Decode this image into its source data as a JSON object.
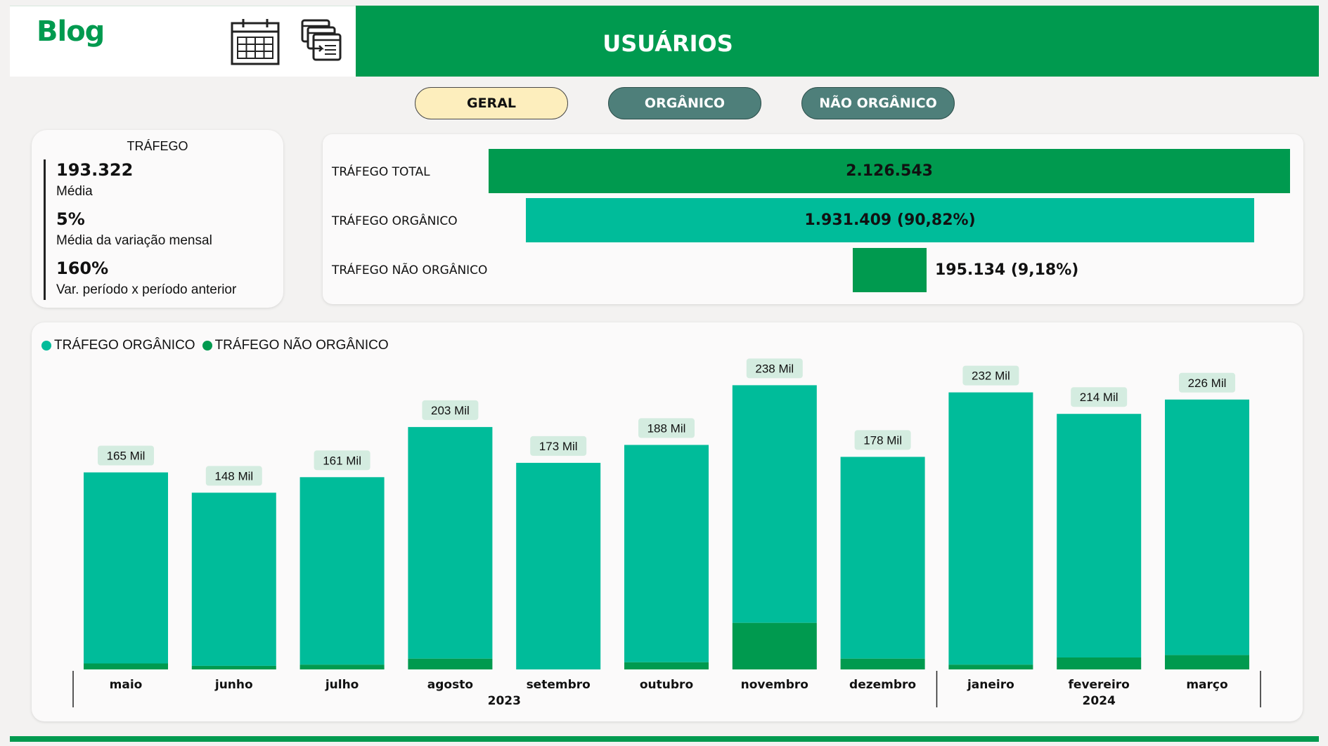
{
  "header": {
    "brand": "Blog",
    "title": "USUÁRIOS",
    "icons": [
      "calendar-table-icon",
      "report-export-icon"
    ]
  },
  "filters": {
    "geral": "GERAL",
    "organico": "ORGÂNICO",
    "nao_organico": "NÃO ORGÂNICO",
    "selected": "GERAL"
  },
  "kpi": {
    "title": "TRÁFEGO",
    "items": [
      {
        "value": "193.322",
        "label": "Média"
      },
      {
        "value": "5%",
        "label": "Média da variação mensal"
      },
      {
        "value": "160%",
        "label": "Var. período x período anterior"
      }
    ]
  },
  "funnel": {
    "rows": [
      {
        "label": "TRÁFEGO TOTAL",
        "value": "2.126.543"
      },
      {
        "label": "TRÁFEGO ORGÂNICO",
        "value": "1.931.409 (90,82%)"
      },
      {
        "label": "TRÁFEGO NÃO ORGÂNICO",
        "value": "195.134 (9,18%)"
      }
    ],
    "values_numeric": [
      2126543,
      1931409,
      195134
    ]
  },
  "colors": {
    "brand_green": "#009a4f",
    "organic": "#00bc9a",
    "non_organic": "#009a4f",
    "pill_selected": "#fdeebd",
    "pill_other": "#4e7f7a",
    "label_bg": "#d4ece0"
  },
  "chart_data": {
    "type": "bar",
    "stacked": true,
    "legend_position": "top-left",
    "grid": false,
    "categories": [
      "maio",
      "junho",
      "julho",
      "agosto",
      "setembro",
      "outubro",
      "novembro",
      "dezembro",
      "janeiro",
      "fevereiro",
      "março"
    ],
    "year_groups": [
      {
        "label": "2023",
        "count": 8
      },
      {
        "label": "2024",
        "count": 3
      }
    ],
    "series": [
      {
        "name": "TRÁFEGO ORGÂNICO",
        "values": [
          160,
          145,
          157,
          194,
          173,
          182,
          199,
          169,
          228,
          204,
          214
        ]
      },
      {
        "name": "TRÁFEGO NÃO ORGÂNICO",
        "values": [
          5,
          3,
          4,
          9,
          0,
          6,
          39,
          9,
          4,
          10,
          12
        ]
      }
    ],
    "totals": [
      165,
      148,
      161,
      203,
      173,
      188,
      238,
      178,
      232,
      214,
      226
    ],
    "total_labels": [
      "165 Mil",
      "148 Mil",
      "161 Mil",
      "203 Mil",
      "173 Mil",
      "188 Mil",
      "238 Mil",
      "178 Mil",
      "232 Mil",
      "214 Mil",
      "226 Mil"
    ],
    "units": "Mil",
    "ylim": [
      0,
      280
    ]
  }
}
